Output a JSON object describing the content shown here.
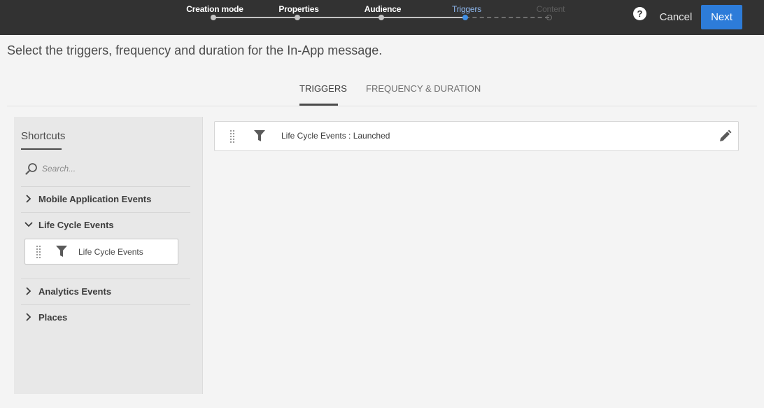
{
  "wizard": {
    "steps": [
      {
        "label": "Creation mode",
        "state": "done"
      },
      {
        "label": "Properties",
        "state": "done"
      },
      {
        "label": "Audience",
        "state": "done"
      },
      {
        "label": "Triggers",
        "state": "active"
      },
      {
        "label": "Content",
        "state": "future"
      }
    ],
    "help_glyph": "?",
    "cancel_label": "Cancel",
    "next_label": "Next"
  },
  "page": {
    "description": "Select the triggers, frequency and duration for the In-App message."
  },
  "tabs": [
    {
      "label": "TRIGGERS",
      "active": true
    },
    {
      "label": "FREQUENCY & DURATION",
      "active": false
    }
  ],
  "shortcuts": {
    "title": "Shortcuts",
    "search_placeholder": "Search...",
    "categories": [
      {
        "label": "Mobile Application Events",
        "expanded": false
      },
      {
        "label": "Life Cycle Events",
        "expanded": true,
        "items": [
          {
            "label": "Life Cycle Events"
          }
        ]
      },
      {
        "label": "Analytics Events",
        "expanded": false
      },
      {
        "label": "Places",
        "expanded": false
      }
    ]
  },
  "triggers": [
    {
      "label": "Life Cycle Events : Launched"
    }
  ],
  "icons": {
    "help": "help-icon",
    "search": "search-icon",
    "chevron_right": "chevron-right-icon",
    "chevron_down": "chevron-down-icon",
    "drag_handle": "drag-handle-icon",
    "filter": "filter-icon",
    "edit": "pencil-icon"
  },
  "colors": {
    "topbar": "#323232",
    "primary_button": "#2d7cd9",
    "active_step": "#8fb8ef",
    "background": "#f4f4f4",
    "panel": "#e8e8e8"
  }
}
